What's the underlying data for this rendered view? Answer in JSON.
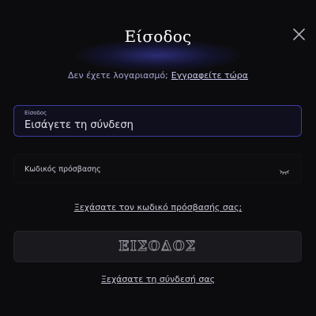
{
  "modal": {
    "title": "Είσοδος",
    "close_icon": "close-icon"
  },
  "signup": {
    "prompt": "Δεν έχετε λογαριασμό;",
    "link": "Εγγραφείτε τώρα"
  },
  "login_field": {
    "label": "Είσοδος",
    "value": "Εισάγετε τη σύνδεση"
  },
  "password_field": {
    "placeholder": "Κωδικός πρόσβασης",
    "toggle_icon": "eye-closed-icon"
  },
  "links": {
    "forgot_password": "Ξεχάσατε τον κωδικό πρόσβασής σας;",
    "forgot_login": "Ξεχάσατε τη σύνδεσή σας"
  },
  "submit": {
    "label": "ΕΙΣΟΔΟΣ"
  },
  "colors": {
    "background": "#0c0c0f",
    "accent_border": "#3d3d9e",
    "link_accent": "#a6a6d6"
  }
}
